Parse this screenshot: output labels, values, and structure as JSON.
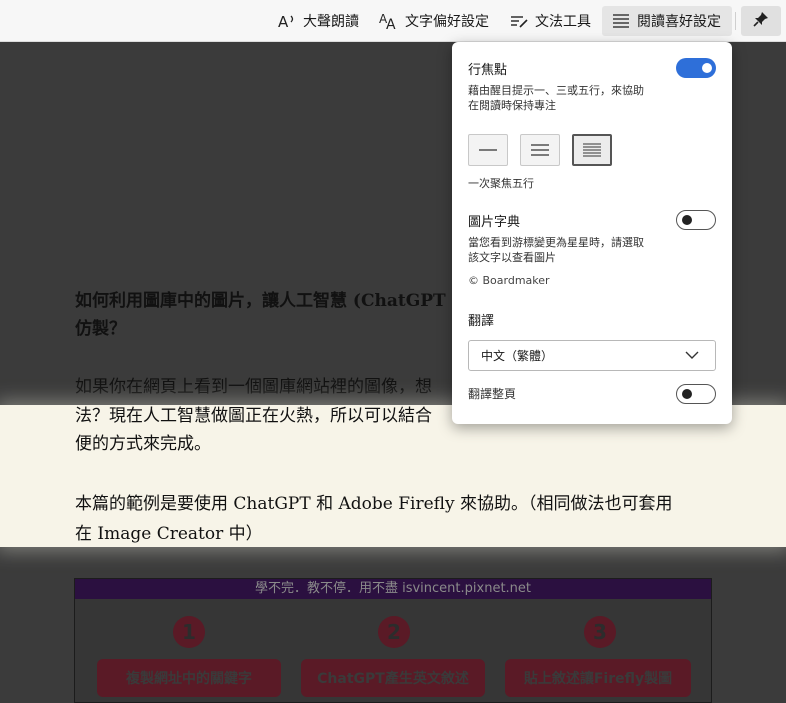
{
  "toolbar": {
    "read_aloud": "大聲朗讀",
    "text_prefs": "文字偏好設定",
    "grammar_tools": "文法工具",
    "reading_prefs": "閱讀喜好設定"
  },
  "article": {
    "heading_line1": "如何利用圖庫中的圖片，讓人工智慧 (ChatGPT",
    "heading_line2": "仿製？",
    "p1_line1": "如果你在網頁上看到一個圖庫網站裡的圖像，想",
    "p1_line2": "法？現在人工智慧做圖正在火熱，所以可以結合",
    "p1_line3": "便的方式來完成。",
    "p2_line1": "本篇的範例是要使用 ChatGPT 和 Adobe Firefly 來協助。（相同做法也可套用",
    "p2_line2": "在 Image Creator 中）"
  },
  "infographic": {
    "header": "學不完．教不停．用不盡 isvincent.pixnet.net",
    "steps": [
      {
        "num": "1",
        "label": "複製網址中的關鍵字"
      },
      {
        "num": "2",
        "label": "ChatGPT產生英文敘述"
      },
      {
        "num": "3",
        "label": "貼上敘述讓Firefly製圖"
      }
    ]
  },
  "popup": {
    "line_focus_title": "行焦點",
    "line_focus_desc_1": "藉由醒目提示一、三或五行，來協助",
    "line_focus_desc_2": "在閱讀時保持專注",
    "line_focus_on": true,
    "focus_caption": "一次聚焦五行",
    "picture_dict_title": "圖片字典",
    "picture_dict_desc_1": "當您看到游標變更為星星時，請選取",
    "picture_dict_desc_2": "該文字以查看圖片",
    "picture_dict_credit": "© Boardmaker",
    "picture_dict_on": false,
    "translate_title": "翻譯",
    "translate_language": "中文（繁體）",
    "translate_page_label": "翻譯整頁",
    "translate_page_on": false
  },
  "icons": {
    "read_aloud": "read-aloud-icon",
    "text_prefs": "text-size-icon",
    "grammar": "grammar-icon",
    "reading_prefs": "lines-icon",
    "pin": "pin-icon"
  },
  "colors": {
    "accent": "#2e6fd9",
    "focus_band": "#f7f4e8",
    "dim_overlay": "#3b3b3b"
  }
}
